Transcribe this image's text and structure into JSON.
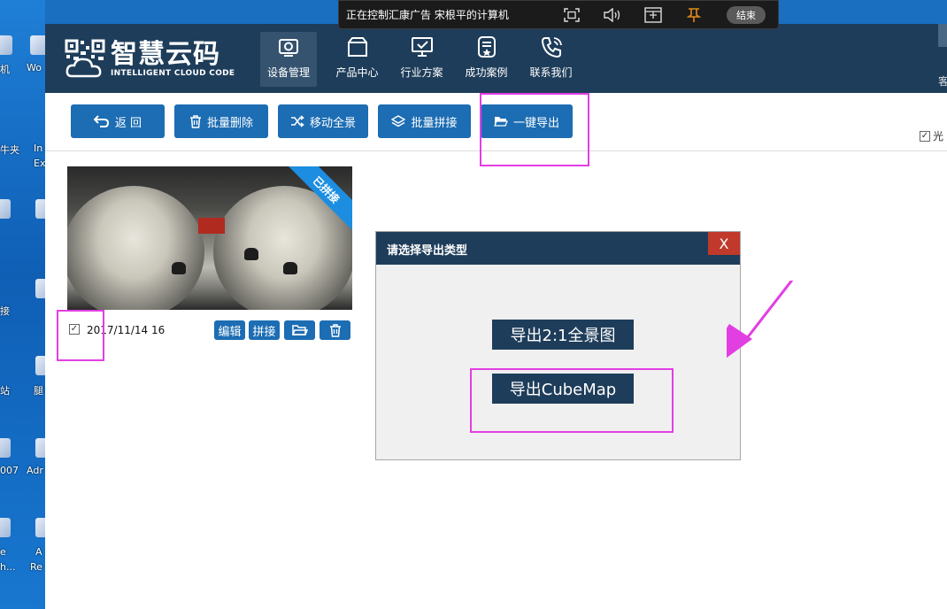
{
  "desktop": {
    "labels": [
      "机",
      "Wo",
      "牛夹",
      "In",
      "Ex",
      "接",
      "站",
      "腿",
      "007",
      "Adr",
      "e",
      "h...",
      "A",
      "Re"
    ]
  },
  "remote": {
    "status_text": "正在控制汇康广告 宋根平的计算机",
    "end_label": "结束"
  },
  "app": {
    "logo": {
      "title": "智慧云码",
      "subtitle": "INTELLIGENT CLOUD CODE"
    },
    "nav": [
      {
        "label": "设备管理",
        "icon": "camera-icon",
        "active": true
      },
      {
        "label": "产品中心",
        "icon": "box-icon",
        "active": false
      },
      {
        "label": "行业方案",
        "icon": "monitor-check-icon",
        "active": false
      },
      {
        "label": "成功案例",
        "icon": "document-star-icon",
        "active": false
      },
      {
        "label": "联系我们",
        "icon": "phone-icon",
        "active": false
      }
    ],
    "header_edge_text": "客",
    "toolbar": {
      "back": "返 回",
      "batch_delete": "批量删除",
      "move_panorama": "移动全景",
      "batch_stitch": "批量拼接",
      "one_click_export": "一键导出"
    },
    "right_checkbox_label": "光",
    "card": {
      "ribbon": "已拼接",
      "date": "2017/11/14 16:",
      "edit": "编辑",
      "stitch": "拼接",
      "checked": true
    },
    "dialog": {
      "title": "请选择导出类型",
      "close": "X",
      "export_panorama": "导出2:1全景图",
      "export_cubemap": "导出CubeMap"
    },
    "colors": {
      "header": "#1e3d5a",
      "button": "#1c6db3",
      "highlight": "#e23fe3"
    }
  }
}
